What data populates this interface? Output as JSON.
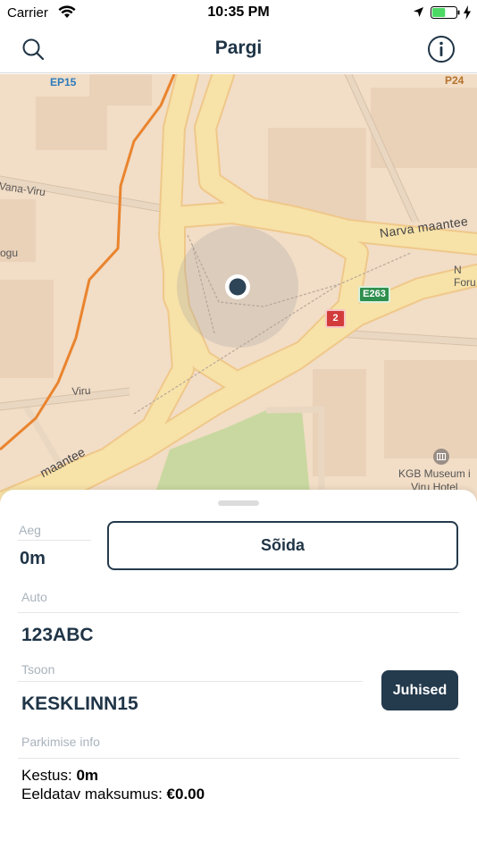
{
  "status_bar": {
    "carrier": "Carrier",
    "time": "10:35 PM",
    "battery_level": 0.55
  },
  "nav": {
    "title": "Pargi",
    "search_icon": "search-icon",
    "info_icon": "info-icon"
  },
  "map": {
    "labels": {
      "ep15": "EP15",
      "p24": "P24",
      "vana_viru": "Vana-Viru",
      "narva_maantee": "Narva maantee",
      "ogu": "ogu",
      "nfor_1": "N",
      "nfor_2": "Foru",
      "viru": "Viru",
      "maantee": "maantee",
      "kgb_1": "KGB Museum i",
      "kgb_2": "Viru Hotel"
    },
    "shields": {
      "e263": "E263",
      "r2": "2"
    },
    "colors": {
      "land": "#f2ddc6",
      "road_fill": "#f7e2a8",
      "road_edge": "#efc88a",
      "primary_line": "#e9842e",
      "park": "#c9d8a0",
      "location_dot": "#2e4457"
    }
  },
  "sheet": {
    "aeg_label": "Aeg",
    "aeg_value": "0m",
    "soida_button": "Sõida",
    "auto_label": "Auto",
    "auto_value": "123ABC",
    "tsoon_label": "Tsoon",
    "tsoon_value": "KESKLINN15",
    "juhised_button": "Juhised",
    "parkimise_label": "Parkimise info",
    "kestus_label": "Kestus:",
    "kestus_value": "0m",
    "maksumus_label": "Eeldatav maksumus:",
    "maksumus_value": "€0.00"
  }
}
